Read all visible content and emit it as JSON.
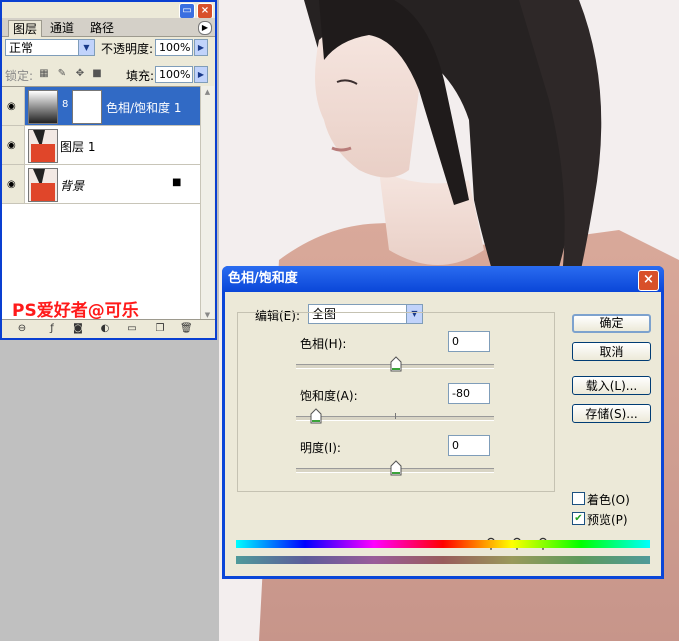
{
  "layers_panel": {
    "tabs": [
      "图层",
      "通道",
      "路径"
    ],
    "blend_mode": "正常",
    "opacity_label": "不透明度:",
    "opacity_value": "100%",
    "lock_label": "锁定:",
    "fill_label": "填充:",
    "fill_value": "100%",
    "layers": [
      {
        "name": "色相/饱和度 1",
        "selected": true
      },
      {
        "name": "图层 1",
        "selected": false
      },
      {
        "name": "背景",
        "selected": false,
        "locked": true
      }
    ],
    "watermark": "PS爱好者@可乐"
  },
  "dialog": {
    "title": "色相/饱和度",
    "edit_label": "编辑(E):",
    "edit_value": "全图",
    "hue_label": "色相(H):",
    "hue_value": "0",
    "saturation_label": "饱和度(A):",
    "saturation_value": "-80",
    "lightness_label": "明度(I):",
    "lightness_value": "0",
    "buttons": {
      "ok": "确定",
      "cancel": "取消",
      "load": "载入(L)...",
      "save": "存储(S)..."
    },
    "colorize_label": "着色(O)",
    "colorize_checked": false,
    "preview_label": "预览(P)",
    "preview_checked": true,
    "slider_levels": {
      "hue": 0.5,
      "saturation": 0.1,
      "lightness": 0.5
    }
  }
}
